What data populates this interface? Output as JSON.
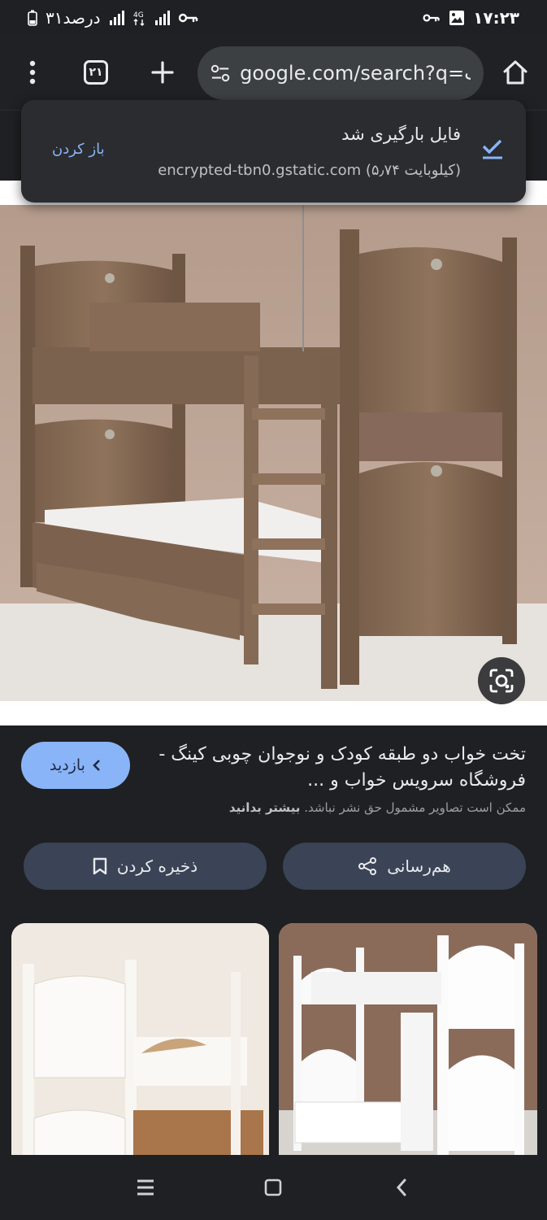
{
  "status_bar": {
    "time": "۱۷:۲۳",
    "battery": "۳۱درصد"
  },
  "toolbar": {
    "tab_count": "۲۱",
    "url": "google.com/search?q=ـب"
  },
  "download_toast": {
    "title": "فایل بارگیری شد",
    "subtitle": "encrypted-tbn0.gstatic.com (۵٫۷۴ کیلوبایت)",
    "open_label": "باز کردن"
  },
  "result": {
    "title": "تخت خواب دو طبقه کودک و نوجوان چوبی کینگ - فروشگاه سرویس خواب و ...",
    "copyright_text": "ممکن است تصاویر مشمول حق نشر نباشد.",
    "learn_more": "بیشتر بدانید",
    "visit_label": "بازدید"
  },
  "actions": {
    "share_label": "هم‌رسانی",
    "save_label": "ذخیره کردن"
  }
}
